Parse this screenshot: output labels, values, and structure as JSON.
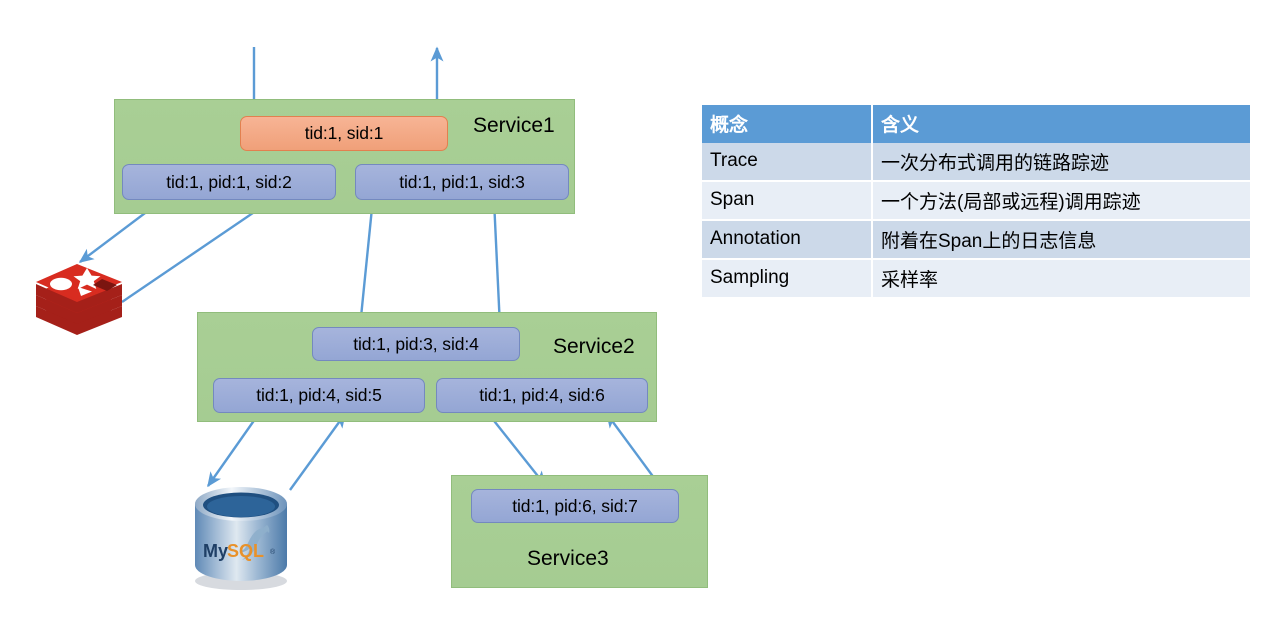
{
  "diagram": {
    "services": [
      {
        "name": "Service1",
        "label": "Service1"
      },
      {
        "name": "Service2",
        "label": "Service2"
      },
      {
        "name": "Service3",
        "label": "Service3"
      }
    ],
    "spans": [
      {
        "id": "root",
        "label": "tid:1, sid:1",
        "service": "Service1",
        "color": "orange"
      },
      {
        "id": "s2",
        "label": "tid:1, pid:1, sid:2",
        "service": "Service1",
        "color": "blue"
      },
      {
        "id": "s3",
        "label": "tid:1, pid:1, sid:3",
        "service": "Service1",
        "color": "blue"
      },
      {
        "id": "s4",
        "label": "tid:1, pid:3, sid:4",
        "service": "Service2",
        "color": "blue"
      },
      {
        "id": "s5",
        "label": "tid:1, pid:4, sid:5",
        "service": "Service2",
        "color": "blue"
      },
      {
        "id": "s6",
        "label": "tid:1, pid:4, sid:6",
        "service": "Service2",
        "color": "blue"
      },
      {
        "id": "s7",
        "label": "tid:1, pid:6, sid:7",
        "service": "Service3",
        "color": "blue"
      }
    ],
    "datastores": [
      {
        "name": "redis",
        "label": "Redis"
      },
      {
        "name": "mysql",
        "label": "MySQL"
      }
    ],
    "colors": {
      "service_green": "#a9cf95",
      "span_blue": "#9fb0d9",
      "span_orange": "#f4a983",
      "arrow_blue": "#5b9bd5",
      "table_header_blue": "#5b9bd5",
      "table_row_dark": "#ccd9e9",
      "table_row_light": "#e8eef6",
      "redis_red": "#d82c20",
      "mysql_blue": "#2a6496"
    }
  },
  "table": {
    "headers": [
      "概念",
      "含义"
    ],
    "rows": [
      [
        "Trace",
        "一次分布式调用的链路踪迹"
      ],
      [
        "Span",
        "一个方法(局部或远程)调用踪迹"
      ],
      [
        "Annotation",
        "附着在Span上的日志信息"
      ],
      [
        "Sampling",
        "采样率"
      ]
    ]
  }
}
